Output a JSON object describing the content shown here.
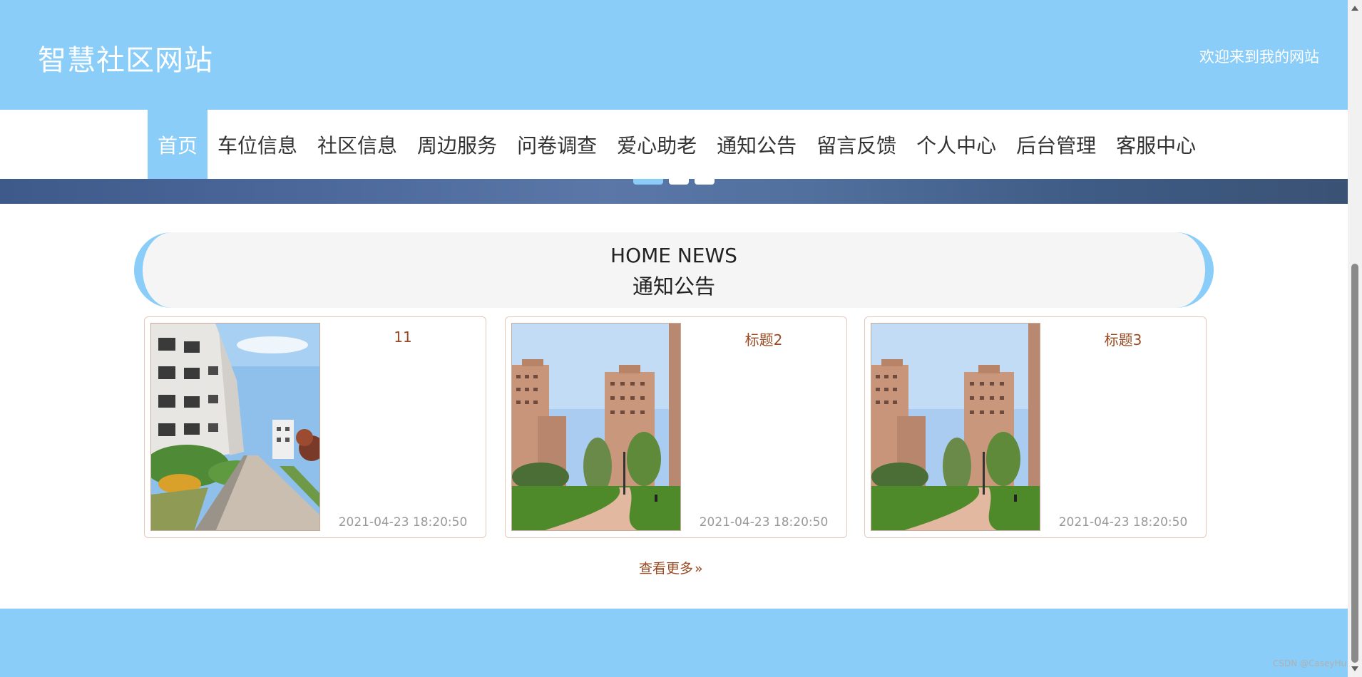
{
  "header": {
    "site_title": "智慧社区网站",
    "welcome_text": "欢迎来到我的网站"
  },
  "nav": {
    "items": [
      {
        "label": "首页",
        "active": true
      },
      {
        "label": "车位信息"
      },
      {
        "label": "社区信息"
      },
      {
        "label": "周边服务"
      },
      {
        "label": "问卷调查"
      },
      {
        "label": "爱心助老"
      },
      {
        "label": "通知公告"
      },
      {
        "label": "留言反馈"
      },
      {
        "label": "个人中心"
      },
      {
        "label": "后台管理"
      },
      {
        "label": "客服中心"
      }
    ]
  },
  "news_section": {
    "title_en": "HOME NEWS",
    "title_cn": "通知公告",
    "cards": [
      {
        "title": "11",
        "date": "2021-04-23 18:20:50",
        "image": "apartment-walkway-photo"
      },
      {
        "title": "标题2",
        "date": "2021-04-23 18:20:50",
        "image": "residential-towers-garden-photo"
      },
      {
        "title": "标题3",
        "date": "2021-04-23 18:20:50",
        "image": "residential-towers-garden-photo"
      }
    ],
    "more_label": "查看更多",
    "more_icon": "double-chevron-right-icon"
  },
  "watermark": "CSDN @CaseyHu",
  "colors": {
    "brand": "#89cdf8",
    "card_title": "#9a4a22",
    "card_border": "#e6c8b8"
  }
}
